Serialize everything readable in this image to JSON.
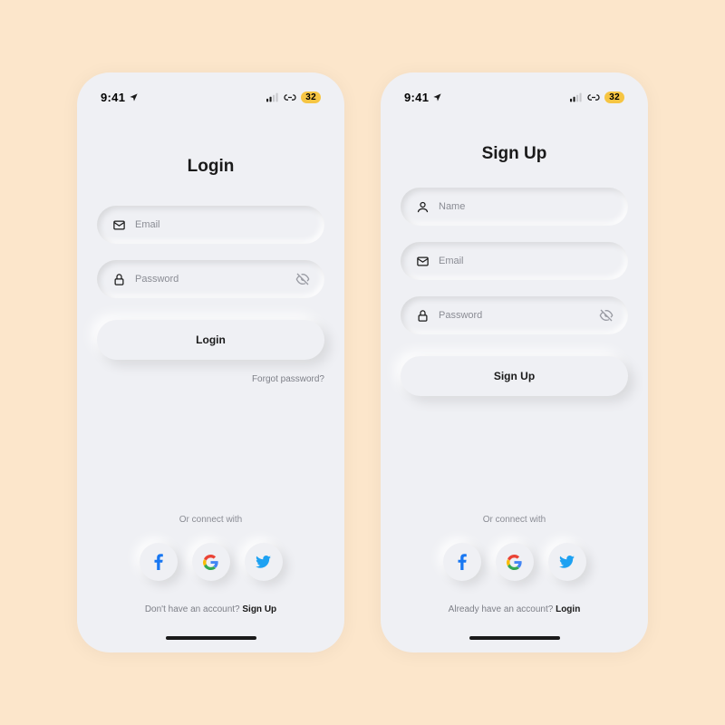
{
  "status": {
    "time": "9:41",
    "battery": "32"
  },
  "login": {
    "title": "Login",
    "email_placeholder": "Email",
    "password_placeholder": "Password",
    "button_label": "Login",
    "forgot_label": "Forgot password?",
    "connect_label": "Or connect with",
    "footer_prompt": "Don't have an account? ",
    "footer_action": "Sign Up"
  },
  "signup": {
    "title": "Sign Up",
    "name_placeholder": "Name",
    "email_placeholder": "Email",
    "password_placeholder": "Password",
    "button_label": "Sign Up",
    "connect_label": "Or connect with",
    "footer_prompt": "Already have an account? ",
    "footer_action": "Login"
  }
}
